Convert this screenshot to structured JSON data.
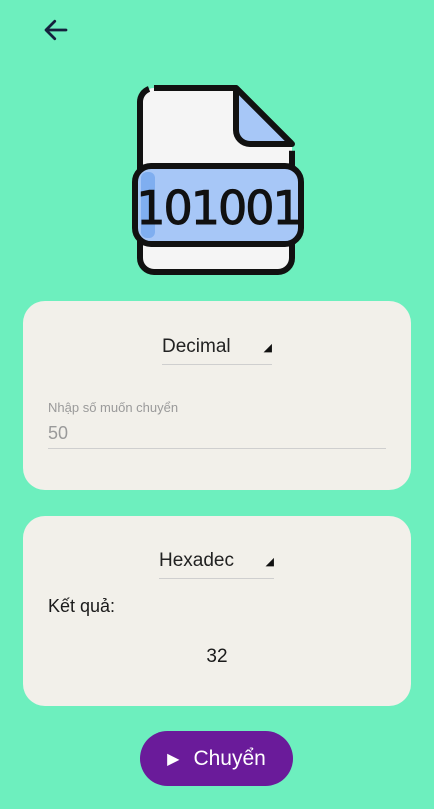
{
  "header": {
    "back_icon": "arrow-left-icon"
  },
  "hero": {
    "icon": "binary-file-icon",
    "digits": "101001"
  },
  "input_card": {
    "from_unit": "Decimal",
    "field_label": "Nhập số muốn chuyển",
    "field_value": "50"
  },
  "output_card": {
    "to_unit": "Hexadec",
    "result_label": "Kết quả:",
    "result_value": "32"
  },
  "convert_button": {
    "label": "Chuyển",
    "icon": "play-icon"
  },
  "colors": {
    "background": "#6DEFBE",
    "card": "#F2F0EA",
    "button": "#6A1B9A",
    "file_accent": "#A7C7F7"
  }
}
